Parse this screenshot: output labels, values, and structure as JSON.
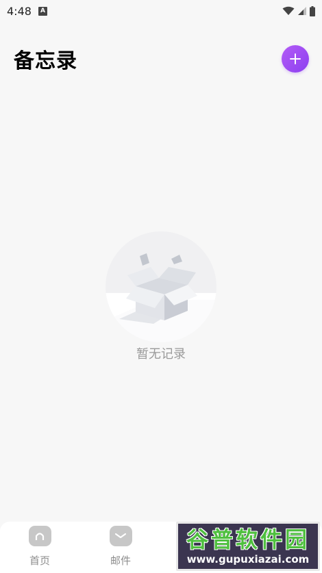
{
  "status_bar": {
    "time": "4:48",
    "notification_badge": "A",
    "icons": [
      "wifi-icon",
      "signal-icon",
      "battery-icon"
    ]
  },
  "header": {
    "title": "备忘录",
    "add_icon": "plus-icon",
    "accent_color": "#a04cf3"
  },
  "empty_state": {
    "message": "暂无记录",
    "illustration": "empty-box-icon"
  },
  "bottom_nav": {
    "items": [
      {
        "label": "首页",
        "icon": "home-icon"
      },
      {
        "label": "邮件",
        "icon": "mail-icon"
      }
    ]
  },
  "watermark": {
    "title": "谷普软件园",
    "url": "www.gupuxiazai.com"
  }
}
